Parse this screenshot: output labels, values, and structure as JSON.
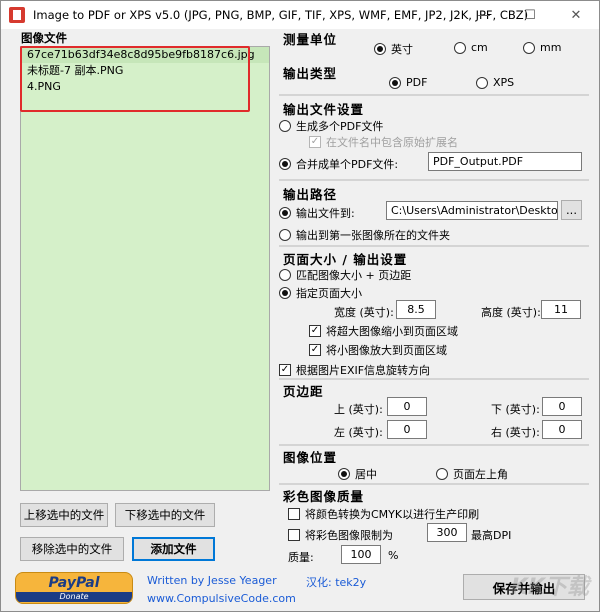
{
  "window": {
    "title": "Image to PDF or XPS  v5.0  (JPG, PNG, BMP, GIF, TIF, XPS, WMF, EMF, JP2, J2K, JPF, CBZ)"
  },
  "files": {
    "label": "图像文件",
    "items": [
      "67ce71b63df34e8c8d95be9fb8187c6.jpg",
      "未标题-7 副本.PNG",
      "4.PNG"
    ]
  },
  "buttons": {
    "move_up": "上移选中的文件",
    "move_down": "下移选中的文件",
    "remove": "移除选中的文件",
    "add": "添加文件",
    "save": "保存并输出",
    "browse": "..."
  },
  "units": {
    "title": "测量单位",
    "options": [
      "英寸",
      "cm",
      "mm"
    ],
    "selected": 0
  },
  "output_type": {
    "title": "输出类型",
    "options": [
      "PDF",
      "XPS"
    ],
    "selected": 0
  },
  "file_settings": {
    "title": "输出文件设置",
    "multiple": "生成多个PDF文件",
    "include_ext": "在文件名中包含原始扩展名",
    "merge": "合并成单个PDF文件:",
    "filename": "PDF_Output.PDF"
  },
  "output_path": {
    "title": "输出路径",
    "to_folder": "输出文件到:",
    "folder_value": "C:\\Users\\Administrator\\Desktop",
    "to_first": "输出到第一张图像所在的文件夹"
  },
  "page_size": {
    "title": "页面大小 / 输出设置",
    "match": "匹配图像大小 + 页边距",
    "specify": "指定页面大小",
    "width_label": "宽度 (英寸):",
    "width": "8.5",
    "height_label": "高度 (英寸):",
    "height": "11",
    "shrink": "将超大图像缩小到页面区域",
    "enlarge": "将小图像放大到页面区域",
    "exif": "根据图片EXIF信息旋转方向"
  },
  "margins": {
    "title": "页边距",
    "top_label": "上 (英寸):",
    "top": "0",
    "bottom_label": "下 (英寸):",
    "bottom": "0",
    "left_label": "左 (英寸):",
    "left": "0",
    "right_label": "右 (英寸):",
    "right": "0"
  },
  "position": {
    "title": "图像位置",
    "center": "居中",
    "top_left": "页面左上角"
  },
  "color": {
    "title": "彩色图像质量",
    "cmyk": "将颜色转换为CMYK以进行生产印刷",
    "limit": "将彩色图像限制为",
    "dpi_value": "300",
    "dpi_label": "最高DPI",
    "quality_label": "质量:",
    "quality": "100",
    "percent": "%"
  },
  "footer": {
    "paypal": "PayPal",
    "donate": "Donate",
    "author": "Written by Jesse Yeager",
    "site": "www.CompulsiveCode.com",
    "localize": "汉化: tek2y",
    "watermark": "KK下载"
  },
  "colors": {
    "list_bg": "#d5f0c9",
    "highlight": "#e02b2b",
    "link": "#1a5bd6",
    "default_button": "#0078d7"
  }
}
